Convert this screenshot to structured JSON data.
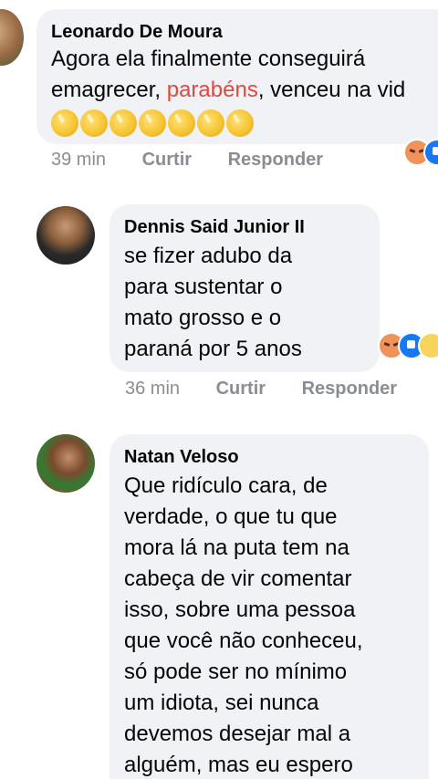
{
  "comments": [
    {
      "author": "Leonardo De Moura",
      "text_before": "Agora ela finalmente conseguirá emagrecer, ",
      "text_highlight": "parabéns",
      "text_after": ", venceu na vid",
      "emoji": "clapping-hands x7",
      "time": "39 min",
      "like_label": "Curtir",
      "reply_label": "Responder",
      "reactions": [
        "angry",
        "like"
      ]
    },
    {
      "author": "Dennis Said Junior II",
      "text": "se fizer adubo da\npara sustentar o\nmato grosso e o\nparaná por 5 anos",
      "time": "36 min",
      "like_label": "Curtir",
      "reply_label": "Responder",
      "reactions": [
        "angry",
        "like",
        "haha"
      ]
    },
    {
      "author": "Natan Veloso",
      "text": "Que ridículo cara, de\nverdade, o que tu que\nmora lá na puta tem na\ncabeça de vir comentar\nisso, sobre uma pessoa\nque você não conheceu,\nsó pode ser no mínimo\num idiota, sei nunca\ndevemos desejar mal a\nalguém, mas eu espero"
    }
  ],
  "colors": {
    "bubble": "#f0f2f5",
    "highlight": "#e0493e",
    "meta": "#8a8d91"
  }
}
